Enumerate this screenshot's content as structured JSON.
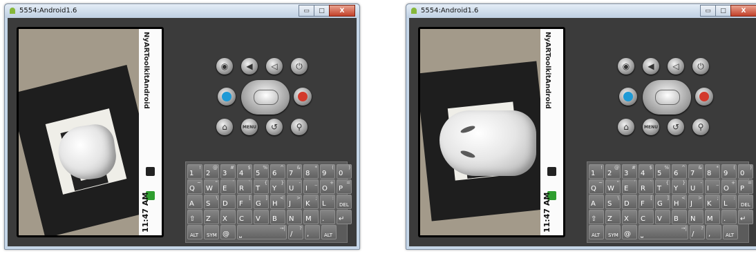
{
  "windows": [
    {
      "title": "5554:Android1.6",
      "controls": {
        "minimize": "▭",
        "maximize": "□",
        "close": "X"
      },
      "status_bar": {
        "app_title": "NyARToolkitAndroid",
        "time": "11:47 AM"
      },
      "keyboard": {
        "rows": [
          [
            {
              "m": "1",
              "a": "!"
            },
            {
              "m": "2",
              "a": "@"
            },
            {
              "m": "3",
              "a": "#"
            },
            {
              "m": "4",
              "a": "$"
            },
            {
              "m": "5",
              "a": "%"
            },
            {
              "m": "6",
              "a": "^"
            },
            {
              "m": "7",
              "a": "&"
            },
            {
              "m": "8",
              "a": "*"
            },
            {
              "m": "9",
              "a": "("
            },
            {
              "m": "0",
              "a": ")"
            }
          ],
          [
            {
              "m": "Q",
              "a": "~"
            },
            {
              "m": "W",
              "a": "\""
            },
            {
              "m": "E",
              "a": "´"
            },
            {
              "m": "R",
              "a": "`"
            },
            {
              "m": "T",
              "a": "{"
            },
            {
              "m": "Y",
              "a": "}"
            },
            {
              "m": "U",
              "a": "-"
            },
            {
              "m": "I",
              "a": "_"
            },
            {
              "m": "O",
              "a": "+"
            },
            {
              "m": "P",
              "a": "="
            }
          ],
          [
            {
              "m": "A",
              "a": ""
            },
            {
              "m": "S",
              "a": "\\"
            },
            {
              "m": "D",
              "a": ""
            },
            {
              "m": "F",
              "a": "["
            },
            {
              "m": "G",
              "a": "]"
            },
            {
              "m": "H",
              "a": "<"
            },
            {
              "m": "J",
              "a": ">"
            },
            {
              "m": "K",
              "a": ";"
            },
            {
              "m": "L",
              "a": ":"
            },
            {
              "m": "DEL",
              "a": ""
            }
          ],
          [
            {
              "m": "⇧",
              "a": ""
            },
            {
              "m": "Z",
              "a": ""
            },
            {
              "m": "X",
              "a": ""
            },
            {
              "m": "C",
              "a": ""
            },
            {
              "m": "V",
              "a": ""
            },
            {
              "m": "B",
              "a": ""
            },
            {
              "m": "N",
              "a": ""
            },
            {
              "m": "M",
              "a": ""
            },
            {
              "m": ".",
              "a": ""
            },
            {
              "m": "↵",
              "a": ""
            }
          ],
          [
            {
              "m": "ALT",
              "a": ""
            },
            {
              "m": "SYM",
              "a": ""
            },
            {
              "m": "@",
              "a": ""
            },
            {
              "m": "⎵",
              "a": "→|"
            },
            {
              "m": "/",
              "a": "?"
            },
            {
              "m": ",",
              "a": ""
            },
            {
              "m": "ALT",
              "a": ""
            }
          ]
        ]
      },
      "buttons": {
        "menu": "MENU"
      }
    },
    {
      "title": "5554:Android1.6",
      "controls": {
        "minimize": "▭",
        "maximize": "□",
        "close": "X"
      },
      "status_bar": {
        "app_title": "NyARToolkitAndroid",
        "time": "11:47 AM"
      },
      "buttons": {
        "menu": "MENU"
      }
    }
  ],
  "icons": [
    "camera-icon",
    "volume-down-icon",
    "volume-up-icon",
    "power-icon",
    "call-icon",
    "end-call-icon",
    "home-icon",
    "back-icon",
    "search-icon"
  ],
  "colors": {
    "call": "#1e9ad6",
    "end_call": "#d33a2c",
    "status_green": "#2f9e2f"
  }
}
